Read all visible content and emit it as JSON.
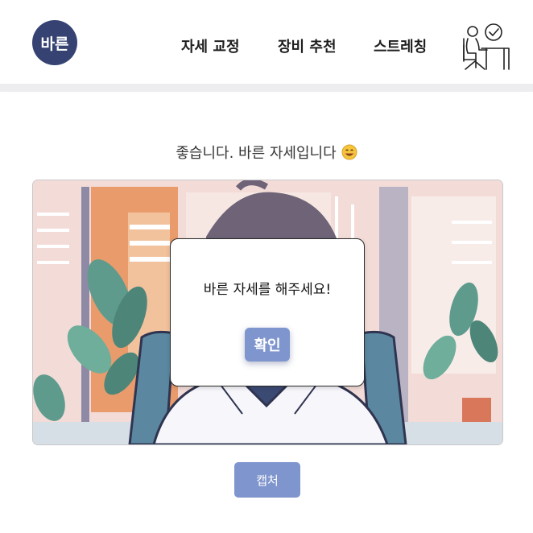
{
  "header": {
    "logo_text": "바른",
    "nav": [
      {
        "label": "자세 교정"
      },
      {
        "label": "장비 추천"
      },
      {
        "label": "스트레칭"
      }
    ],
    "user_icon": "desk-posture-icon"
  },
  "main": {
    "status_message": "좋습니다. 바른 자세입니다",
    "status_emoji": "smiling-face-icon",
    "camera_view": "webcam-feed",
    "capture_label": "캡처"
  },
  "modal": {
    "message": "바른 자세를 해주세요!",
    "confirm_label": "확인"
  },
  "colors": {
    "brand_navy": "#364372",
    "button_blue": "#7f95cd",
    "nav_text": "#1e1e1e"
  }
}
